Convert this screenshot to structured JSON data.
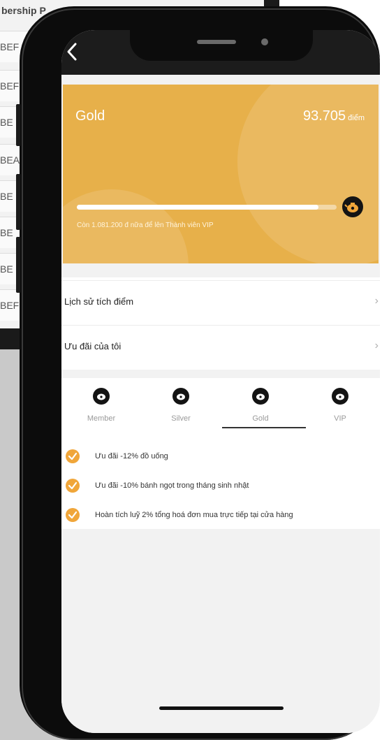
{
  "background": {
    "header_text": "bership P",
    "row_texts": [
      "BEF",
      "BEF",
      "BE",
      "BEA",
      "BE",
      "BE",
      "BE",
      "BEF"
    ]
  },
  "card": {
    "level": "Gold",
    "points": "93.705",
    "points_unit": "điểm",
    "progress_fraction": 0.93,
    "note": "Còn 1.081.200 đ nữa để lên Thành viên VIP",
    "color": "#e7b04a"
  },
  "menu": {
    "history": "Lịch sử tích điểm",
    "offers": "Ưu đãi của tôi"
  },
  "tiers": [
    {
      "label": "Member",
      "icon": "teapot-icon"
    },
    {
      "label": "Silver",
      "icon": "teapot-icon"
    },
    {
      "label": "Gold",
      "icon": "teapot-icon"
    },
    {
      "label": "VIP",
      "icon": "teapot-icon"
    }
  ],
  "active_tier": "Gold",
  "benefits": [
    "Ưu đãi -12% đồ uống",
    "Ưu đãi -10% bánh ngọt trong tháng sinh nhật",
    "Hoàn tích luỹ 2% tổng hoá đơn mua trực tiếp tại cửa hàng"
  ],
  "accent_color": "#f0a63a"
}
